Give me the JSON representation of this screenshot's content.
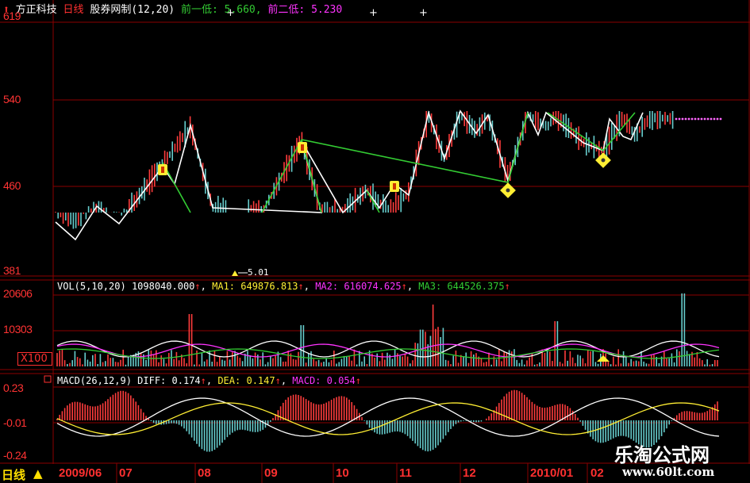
{
  "header": {
    "stock_name": "方正科技",
    "period": "日线",
    "indicator": "股券网制(12,20)",
    "prev_low1_label": "前一低:",
    "prev_low1_value": "5.660,",
    "prev_low2_label": "前二低:",
    "prev_low2_value": "5.230"
  },
  "price_axis": {
    "labels": [
      "619",
      "540",
      "460",
      "381"
    ]
  },
  "vol_panel": {
    "title": "VOL(5,10,20)",
    "value": "1098040.000",
    "ma1_label": "MA1:",
    "ma1_value": "649876.813",
    "ma2_label": "MA2:",
    "ma2_value": "616074.625",
    "ma3_label": "MA3:",
    "ma3_value": "644526.375",
    "arrow": "↑",
    "axis": [
      "20606",
      "10303"
    ],
    "unit_label": "X100"
  },
  "macd_panel": {
    "title": "MACD(26,12,9)",
    "diff_label": "DIFF:",
    "diff_value": "0.174",
    "dea_label": "DEA:",
    "dea_value": "0.147",
    "macd_label": "MACD:",
    "macd_value": "0.054",
    "arrow": "↑",
    "axis": [
      "0.23",
      "-0.01",
      "-0.24"
    ]
  },
  "time_axis": {
    "period_button": "日线",
    "months": [
      "2009/06",
      "07",
      "08",
      "09",
      "10",
      "11",
      "12",
      "2010/01",
      "02"
    ]
  },
  "bottom_marker": "5.01",
  "watermark": {
    "name": "乐淘公式网",
    "url": "www.60lt.com"
  },
  "colors": {
    "grid": "#8b0000",
    "axis_text": "#ff3333",
    "up": "#ff3c3c",
    "down": "#66cccc",
    "zigzag": "#ffffff",
    "trendline": "#33cc33",
    "ma1": "#ffffff",
    "ma2": "#ff33ff",
    "ma3": "#33cc33",
    "macd_diff": "#ffffff",
    "macd_dea": "#ffee33",
    "signal": "#ffee33"
  }
}
